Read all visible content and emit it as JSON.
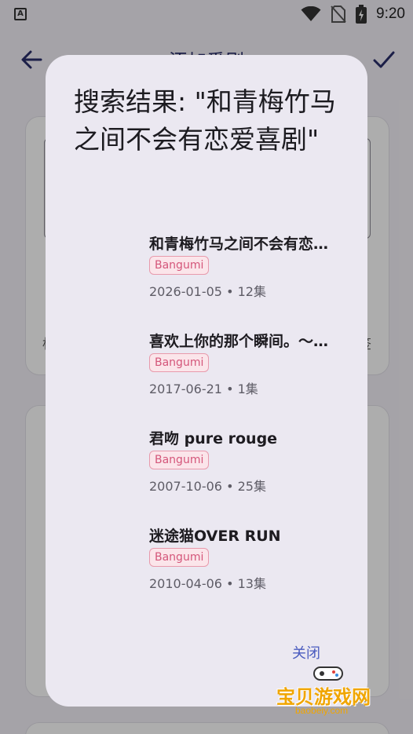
{
  "status_bar": {
    "time": "9:20",
    "app_icon_glyph": "A"
  },
  "app_bar": {
    "title": "添加番剧",
    "back_icon": "arrow-left-icon",
    "confirm_icon": "check-icon"
  },
  "background": {
    "note_left": "标",
    "note_right": "签"
  },
  "dialog": {
    "title": "搜索结果: \"和青梅竹马之间不会有恋爱喜剧\"",
    "results": [
      {
        "name": "和青梅竹马之间不会有恋爱喜剧",
        "source": "Bangumi",
        "meta": "2026-01-05 • 12集"
      },
      {
        "name": "喜欢上你的那个瞬间。～告白实行委员会～",
        "source": "Bangumi",
        "meta": "2017-06-21 • 1集"
      },
      {
        "name": "君吻 pure rouge",
        "source": "Bangumi",
        "meta": "2007-10-06 • 25集"
      },
      {
        "name": "迷途猫OVER RUN",
        "source": "Bangumi",
        "meta": "2010-04-06 • 13集"
      }
    ],
    "close_label": "关闭"
  },
  "watermark": {
    "text": "宝贝游戏网",
    "url": "baobeiy.com"
  },
  "colors": {
    "accent": "#4a5bbf",
    "tag_text": "#d4567a",
    "tag_border": "#e89aac",
    "dialog_bg": "#ebe8f1"
  }
}
